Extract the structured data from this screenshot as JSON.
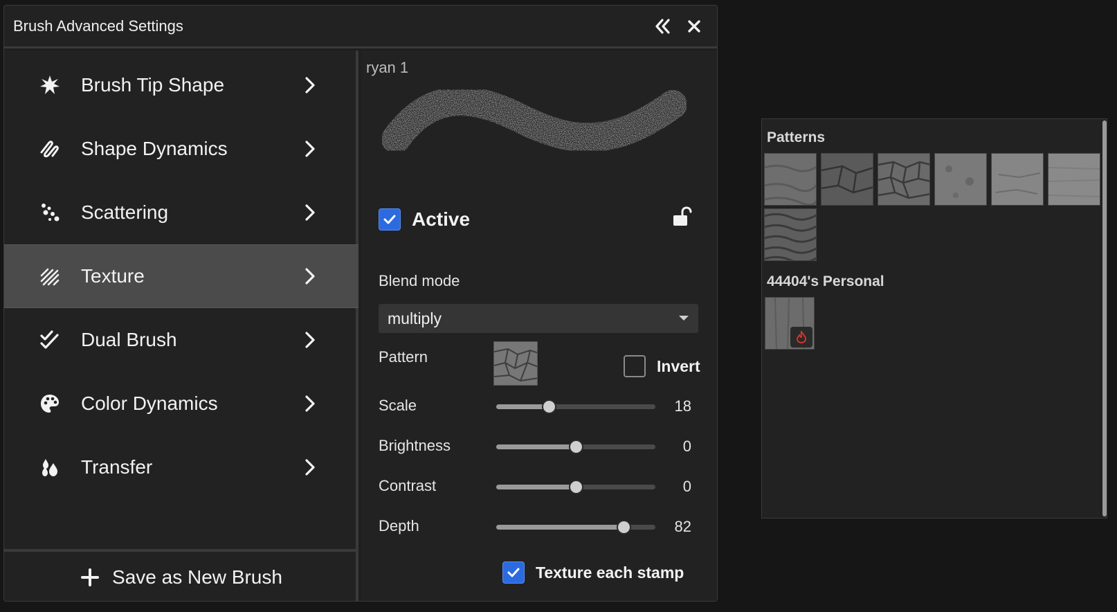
{
  "window": {
    "title": "Brush Advanced Settings"
  },
  "categories": [
    {
      "label": "Brush Tip Shape",
      "icon": "burst-icon"
    },
    {
      "label": "Shape Dynamics",
      "icon": "squiggle-icon"
    },
    {
      "label": "Scattering",
      "icon": "dots-icon"
    },
    {
      "label": "Texture",
      "icon": "hatch-icon",
      "active": true
    },
    {
      "label": "Dual Brush",
      "icon": "double-check-icon"
    },
    {
      "label": "Color Dynamics",
      "icon": "palette-icon"
    },
    {
      "label": "Transfer",
      "icon": "drops-icon"
    }
  ],
  "save_button": {
    "label": "Save as New Brush"
  },
  "texture": {
    "brush_name": "ryan 1",
    "active_label": "Active",
    "active_checked": true,
    "blend_mode_label": "Blend mode",
    "blend_mode_value": "multiply",
    "pattern_label": "Pattern",
    "invert_label": "Invert",
    "invert_checked": false,
    "sliders": [
      {
        "label": "Scale",
        "value": "18",
        "fraction": 0.33
      },
      {
        "label": "Brightness",
        "value": "0",
        "fraction": 0.5
      },
      {
        "label": "Contrast",
        "value": "0",
        "fraction": 0.5
      },
      {
        "label": "Depth",
        "value": "82",
        "fraction": 0.8
      }
    ],
    "texture_each_stamp_label": "Texture each stamp",
    "texture_each_stamp_checked": true
  },
  "patterns_panel": {
    "heading": "Patterns",
    "personal_heading": "44404's Personal"
  },
  "colors": {
    "accent": "#2c6ae0",
    "panel": "#222222",
    "active_row": "#4b4b4b"
  }
}
